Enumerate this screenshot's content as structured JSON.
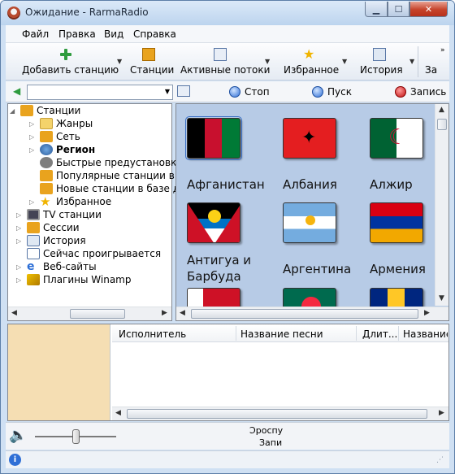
{
  "window": {
    "title": "Ожидание - RarmaRadio",
    "min": "▁",
    "max": "☐",
    "close": "✕"
  },
  "menu": [
    "Файл",
    "Правка",
    "Вид",
    "Справка"
  ],
  "toolbar": {
    "add_station": "Добавить станцию",
    "stations": "Станции",
    "active_streams": "Активные потоки",
    "favorites": "Избранное",
    "history": "История",
    "overflow": "За"
  },
  "controls": {
    "stop": "Стоп",
    "play": "Пуск",
    "record": "Запись"
  },
  "tree": [
    {
      "label": "Станции",
      "bold": false
    },
    {
      "label": "Жанры",
      "bold": false
    },
    {
      "label": "Сеть",
      "bold": false
    },
    {
      "label": "Регион",
      "bold": true
    },
    {
      "label": "Быстрые предустановки",
      "bold": false
    },
    {
      "label": "Популярные станции в ба",
      "bold": false
    },
    {
      "label": "Новые станции в базе дан",
      "bold": false
    },
    {
      "label": "Избранное",
      "bold": false
    },
    {
      "label": "TV станции",
      "bold": false
    },
    {
      "label": "Сессии",
      "bold": false
    },
    {
      "label": "История",
      "bold": false
    },
    {
      "label": "Сейчас проигрывается",
      "bold": false
    },
    {
      "label": "Веб-сайты",
      "bold": false
    },
    {
      "label": "Плагины Winamp",
      "bold": false
    }
  ],
  "countries": [
    "Афганистан",
    "Албания",
    "Алжир",
    "Антигуа и Барбуда",
    "Аргентина",
    "Армения"
  ],
  "table": {
    "columns": [
      "Исполнитель",
      "Название песни",
      "Длит...",
      "Название"
    ]
  },
  "player": {
    "status_line1": "Ͻроспу",
    "status_line2": "Запи"
  },
  "colors": {
    "accent": "#3a6fc5",
    "pane_bg": "#b7cbe6",
    "art_bg": "#f5deb3"
  }
}
